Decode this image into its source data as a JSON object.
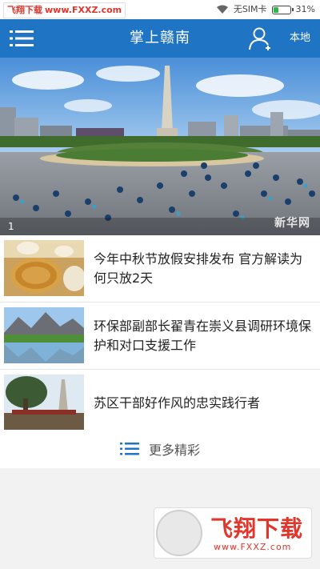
{
  "watermark": {
    "name": "飞翔下载",
    "url": "www.FXXZ.com"
  },
  "status": {
    "sim": "无SIM卡",
    "battery": "31%",
    "battery_level": 0.31
  },
  "header": {
    "title": "掌上赣南",
    "local_label": "本地"
  },
  "banner": {
    "index": "1",
    "source_logo": "新华网"
  },
  "news": [
    {
      "title": "今年中秋节放假安排发布 官方解读为何只放2天"
    },
    {
      "title": "环保部副部长翟青在崇义县调研环境保护和对口支援工作"
    },
    {
      "title": "苏区干部好作风的忠实践行者"
    }
  ],
  "more": {
    "label": "更多精彩"
  },
  "colors": {
    "brand_blue": "#1f74c4",
    "watermark_red": "#e0362b"
  }
}
